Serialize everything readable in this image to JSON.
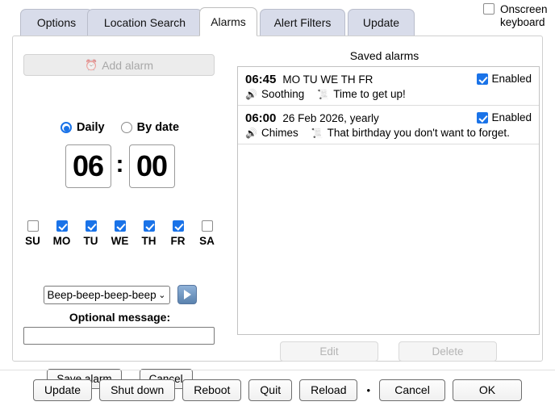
{
  "tabs": [
    {
      "label": "Options",
      "active": false
    },
    {
      "label": "Location Search",
      "active": false
    },
    {
      "label": "Alarms",
      "active": true
    },
    {
      "label": "Alert Filters",
      "active": false
    },
    {
      "label": "Update",
      "active": false
    }
  ],
  "onscreen_keyboard": {
    "label_line1": "Onscreen",
    "label_line2": "keyboard",
    "checked": false
  },
  "editor": {
    "add_alarm_label": "Add alarm",
    "add_alarm_icon": "alarm-clock-icon",
    "add_alarm_icon_glyph": "⏰",
    "add_alarm_disabled": true,
    "mode_daily_label": "Daily",
    "mode_bydate_label": "By date",
    "mode_selected": "Daily",
    "hour": "06",
    "minute": "00",
    "time_separator": ":",
    "days": [
      {
        "name": "SU",
        "checked": false
      },
      {
        "name": "MO",
        "checked": true
      },
      {
        "name": "TU",
        "checked": true
      },
      {
        "name": "WE",
        "checked": true
      },
      {
        "name": "TH",
        "checked": true
      },
      {
        "name": "FR",
        "checked": true
      },
      {
        "name": "SA",
        "checked": false
      }
    ],
    "sound_selected": "Beep-beep-beep-beep",
    "sound_caret": "⌄",
    "play_button_icon": "play-icon",
    "message_label": "Optional message:",
    "message_value": "",
    "message_placeholder": "",
    "save_label": "Save alarm",
    "cancel_label": "Cancel"
  },
  "saved": {
    "title": "Saved alarms",
    "alarms": [
      {
        "time": "06:45",
        "when": "MO TU WE TH FR",
        "enabled_label": "Enabled",
        "enabled": true,
        "sound_icon": "speaker-icon",
        "sound_icon_glyph": "🔊",
        "sound": "Soothing",
        "message_icon": "scroll-icon",
        "message_icon_glyph": "📜",
        "message": "Time to get up!"
      },
      {
        "time": "06:00",
        "when": "26 Feb 2026, yearly",
        "enabled_label": "Enabled",
        "enabled": true,
        "sound_icon": "speaker-icon",
        "sound_icon_glyph": "🔊",
        "sound": "Chimes",
        "message_icon": "scroll-icon",
        "message_icon_glyph": "📜",
        "message": "That birthday you don't want to forget."
      }
    ],
    "edit_label": "Edit",
    "delete_label": "Delete",
    "edit_disabled": true,
    "delete_disabled": true
  },
  "bottom_bar": {
    "update_label": "Update",
    "shutdown_label": "Shut down",
    "reboot_label": "Reboot",
    "quit_label": "Quit",
    "reload_label": "Reload",
    "separator": "•",
    "cancel_label": "Cancel",
    "ok_label": "OK"
  },
  "colors": {
    "tab_inactive_bg": "#d8dcea",
    "tab_active_bg": "#ffffff",
    "accent_checkbox": "#1a73e8",
    "accent_radio": "#1a73e8",
    "play_button_blue": "#5a82ae",
    "disabled_text": "#b4b4b4"
  }
}
